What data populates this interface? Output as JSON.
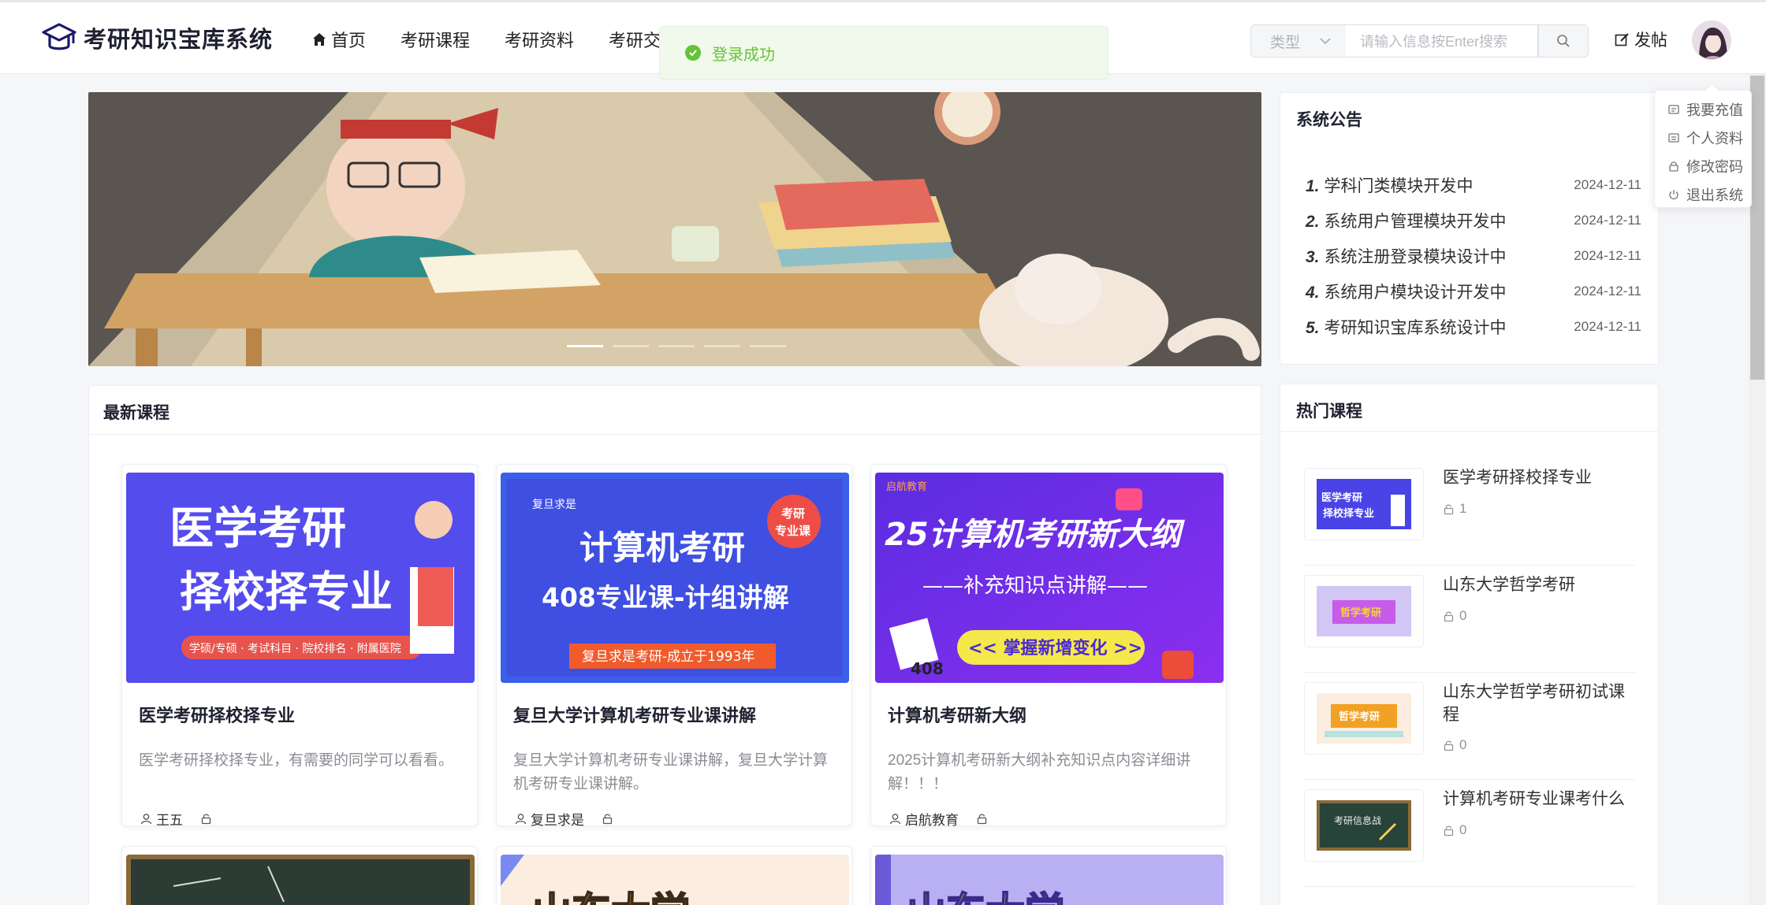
{
  "header": {
    "logo_text": "考研知识宝库系统",
    "nav": [
      "首页",
      "考研课程",
      "考研资料",
      "考研交流"
    ],
    "search_type": "类型",
    "search_placeholder": "请输入信息按Enter搜索",
    "post_label": "发帖"
  },
  "toast": {
    "message": "登录成功"
  },
  "user_menu": [
    "我要充值",
    "个人资料",
    "修改密码",
    "退出系统"
  ],
  "carousel": {
    "slide_count": 5,
    "active_index": 0
  },
  "notice": {
    "title": "系统公告",
    "items": [
      {
        "num": "1.",
        "text": "学科门类模块开发中",
        "date": "2024-12-11"
      },
      {
        "num": "2.",
        "text": "系统用户管理模块开发中",
        "date": "2024-12-11"
      },
      {
        "num": "3.",
        "text": "系统注册登录模块设计中",
        "date": "2024-12-11"
      },
      {
        "num": "4.",
        "text": "系统用户模块设计开发中",
        "date": "2024-12-11"
      },
      {
        "num": "5.",
        "text": "考研知识宝库系统设计中",
        "date": "2024-12-11"
      }
    ]
  },
  "latest": {
    "title": "最新课程",
    "courses": [
      {
        "title": "医学考研择校择专业",
        "desc": "医学考研择校择专业，有需要的同学可以看看。",
        "author": "王五",
        "cover": {
          "line1": "医学考研",
          "line2": "择校择专业",
          "tags": "学硕/专硕 · 考试科目 · 院校排名 · 附属医院"
        }
      },
      {
        "title": "复旦大学计算机考研专业课讲解",
        "desc": "复旦大学计算机考研专业课讲解，复旦大学计算机考研专业课讲解。",
        "author": "复旦求是",
        "cover": {
          "brand": "复旦求是",
          "badge1": "考研",
          "badge2": "专业课",
          "line1": "计算机考研",
          "line2": "408专业课-计组讲解",
          "foot": "复旦求是考研-成立于1993年"
        }
      },
      {
        "title": "计算机考研新大纲",
        "desc": "2025计算机考研新大纲补充知识点内容详细讲解！！！",
        "author": "启航教育",
        "cover": {
          "brand": "启航教育",
          "line1": "25计算机考研新大纲",
          "line2": "——补充知识点讲解——",
          "btn": "<< 掌握新增变化 >>",
          "tag": "408"
        }
      }
    ],
    "row2": [
      {
        "cover_text": ""
      },
      {
        "cover_text": "山东大学"
      },
      {
        "cover_text": "山东大学"
      }
    ]
  },
  "hot": {
    "title": "热门课程",
    "items": [
      {
        "title": "医学考研择校择专业",
        "count": "1",
        "thumb": "医学考研择校择专业"
      },
      {
        "title": "山东大学哲学考研",
        "count": "0",
        "thumb": "哲学考研"
      },
      {
        "title": "山东大学哲学考研初试课程",
        "count": "0",
        "thumb": "哲学考研"
      },
      {
        "title": "计算机考研专业课考什么",
        "count": "0",
        "thumb": "考研信息战"
      }
    ]
  },
  "colors": {
    "accent_green": "#67c23a",
    "banner_bg": "#5d5650",
    "purple": "#5b3df5"
  }
}
